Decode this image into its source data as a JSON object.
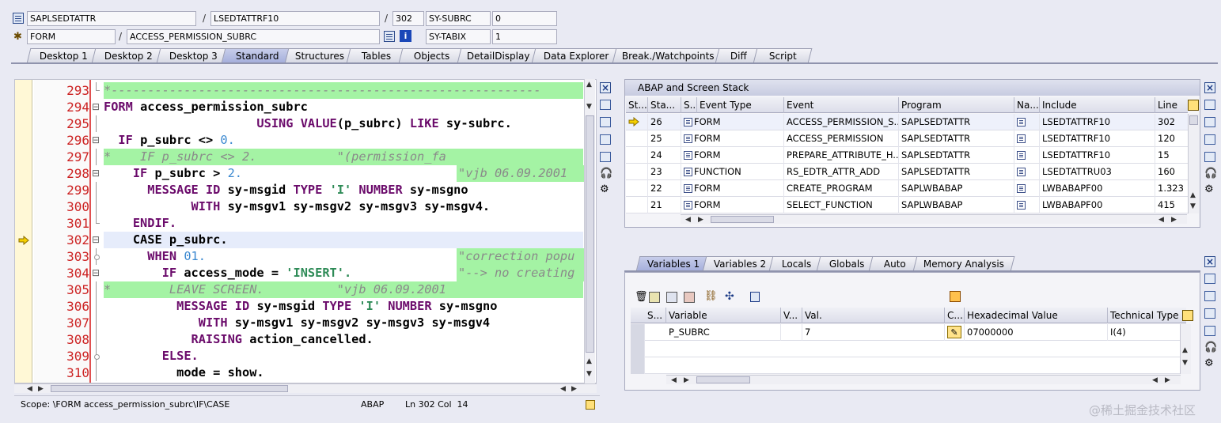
{
  "header": {
    "program": "SAPLSEDTATTR",
    "include": "LSEDTATTRF10",
    "line": "302",
    "subrc_label": "SY-SUBRC",
    "subrc_value": "0",
    "event_type": "FORM",
    "event_name": "ACCESS_PERMISSION_SUBRC",
    "tabix_label": "SY-TABIX",
    "tabix_value": "1"
  },
  "tabs": [
    "Desktop 1",
    "Desktop 2",
    "Desktop 3",
    "Standard",
    "Structures",
    "Tables",
    "Objects",
    "DetailDisplay",
    "Data Explorer",
    "Break./Watchpoints",
    "Diff",
    "Script"
  ],
  "active_tab": "Standard",
  "editor": {
    "lines": [
      {
        "n": "293"
      },
      {
        "n": "294"
      },
      {
        "n": "295"
      },
      {
        "n": "296"
      },
      {
        "n": "297"
      },
      {
        "n": "298"
      },
      {
        "n": "299"
      },
      {
        "n": "300"
      },
      {
        "n": "301"
      },
      {
        "n": "302"
      },
      {
        "n": "303"
      },
      {
        "n": "304"
      },
      {
        "n": "305"
      },
      {
        "n": "306"
      },
      {
        "n": "307"
      },
      {
        "n": "308"
      },
      {
        "n": "309"
      },
      {
        "n": "310"
      }
    ],
    "code": {
      "l293": "*-----------------------------------------------------------",
      "l294_kw": "FORM",
      "l294_id": "access_permission_subrc",
      "l295_kw1": "USING",
      "l295_kw2": "VALUE",
      "l295_id": "(p_subrc)",
      "l295_kw3": "LIKE",
      "l295_id2": "sy-subrc.",
      "l296_kw": "IF",
      "l296_id": "p_subrc <>",
      "l296_num": "0.",
      "l297_a": "*    IF p_subrc <> 2.",
      "l297_b": "\"(permission_fa",
      "l298_kw": "IF",
      "l298_id": "p_subrc >",
      "l298_num": "2.",
      "l298_c": "\"vjb 06.09.2001",
      "l299_kw1": "MESSAGE ID",
      "l299_id1": "sy-msgid",
      "l299_kw2": "TYPE",
      "l299_s": "'I'",
      "l299_kw3": "NUMBER",
      "l299_id2": "sy-msgno",
      "l300_kw": "WITH",
      "l300_id": "sy-msgv1 sy-msgv2 sy-msgv3 sy-msgv4.",
      "l301_kw": "ENDIF.",
      "l302_kw": "CASE",
      "l302_id": "p_subrc.",
      "l303_kw": "WHEN",
      "l303_num": "01.",
      "l303_c": "\"correction popu",
      "l304_kw": "IF",
      "l304_id": "access_mode =",
      "l304_s": "'INSERT'.",
      "l304_c": "\"--> no creating",
      "l305_a": "*        LEAVE SCREEN.",
      "l305_b": "\"vjb 06.09.2001",
      "l306_kw1": "MESSAGE ID",
      "l306_id1": "sy-msgid",
      "l306_kw2": "TYPE",
      "l306_s": "'I'",
      "l306_kw3": "NUMBER",
      "l306_id2": "sy-msgno",
      "l307_kw": "WITH",
      "l307_id": "sy-msgv1 sy-msgv2 sy-msgv3 sy-msgv4",
      "l308_kw": "RAISING",
      "l308_id": "action_cancelled.",
      "l309_kw": "ELSE.",
      "l310_id": "mode =",
      "l310_id2": "show."
    }
  },
  "status": {
    "scope": "Scope: \\FORM access_permission_subrc\\IF\\CASE",
    "lang": "ABAP",
    "position": "Ln 302 Col  14"
  },
  "stack": {
    "title": "ABAP and Screen Stack",
    "columns": [
      "St...",
      "Sta...",
      "S...",
      "Event Type",
      "Event",
      "Program",
      "Na...",
      "Include",
      "Line"
    ],
    "rows": [
      {
        "level": "26",
        "type": "FORM",
        "event": "ACCESS_PERMISSION_S...",
        "program": "SAPLSEDTATTR",
        "include": "LSEDTATTRF10",
        "line": "302",
        "current": true
      },
      {
        "level": "25",
        "type": "FORM",
        "event": "ACCESS_PERMISSION",
        "program": "SAPLSEDTATTR",
        "include": "LSEDTATTRF10",
        "line": "120"
      },
      {
        "level": "24",
        "type": "FORM",
        "event": "PREPARE_ATTRIBUTE_H...",
        "program": "SAPLSEDTATTR",
        "include": "LSEDTATTRF10",
        "line": "15"
      },
      {
        "level": "23",
        "type": "FUNCTION",
        "event": "RS_EDTR_ATTR_ADD",
        "program": "SAPLSEDTATTR",
        "include": "LSEDTATTRU03",
        "line": "160"
      },
      {
        "level": "22",
        "type": "FORM",
        "event": "CREATE_PROGRAM",
        "program": "SAPLWBABAP",
        "include": "LWBABAPF00",
        "line": "1.323"
      },
      {
        "level": "21",
        "type": "FORM",
        "event": "SELECT_FUNCTION",
        "program": "SAPLWBABAP",
        "include": "LWBABAPF00",
        "line": "415"
      }
    ]
  },
  "var_tabs": [
    "Variables 1",
    "Variables 2",
    "Locals",
    "Globals",
    "Auto",
    "Memory Analysis"
  ],
  "vars": {
    "columns": [
      "S...",
      "Variable",
      "V...",
      "Val.",
      "C...",
      "Hexadecimal Value",
      "Technical Type"
    ],
    "rows": [
      {
        "name": "P_SUBRC",
        "value": "7",
        "hex": "07000000",
        "type": "I(4)"
      }
    ]
  },
  "watermark": "@稀土掘金技术社区"
}
